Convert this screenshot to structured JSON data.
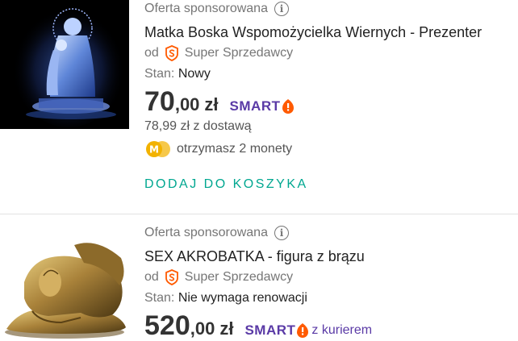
{
  "listings": [
    {
      "sponsored_label": "Oferta sponsorowana",
      "info_icon": "i",
      "title": "Matka Boska Wspomożycielka Wiernych - Prezenter",
      "seller_prefix": "od",
      "seller_name": "Super Sprzedawcy",
      "condition_label": "Stan:",
      "condition_value": "Nowy",
      "price_int": "70",
      "price_dec": ",00",
      "price_currency": "zł",
      "smart_label": "SMART",
      "delivery": "78,99 zł z dostawą",
      "coins_text": "otrzymasz 2 monety",
      "add_to_cart": "DODAJ DO KOSZYKA"
    },
    {
      "sponsored_label": "Oferta sponsorowana",
      "info_icon": "i",
      "title": "SEX AKROBATKA - figura z brązu",
      "seller_prefix": "od",
      "seller_name": "Super Sprzedawcy",
      "condition_label": "Stan:",
      "condition_value": "Nie wymaga renowacji",
      "price_int": "520",
      "price_dec": ",00",
      "price_currency": "zł",
      "smart_label": "SMART",
      "smart_suffix": "z kurierem"
    }
  ],
  "colors": {
    "accent_teal": "#00a790",
    "smart_purple": "#5a3aa6",
    "smart_orange": "#ff5a00",
    "super_seller_orange": "#ff5a00",
    "coin_yellow": "#f2b200"
  },
  "icons": [
    "info-icon",
    "super-seller-icon",
    "smart-icon",
    "coin-icon"
  ]
}
